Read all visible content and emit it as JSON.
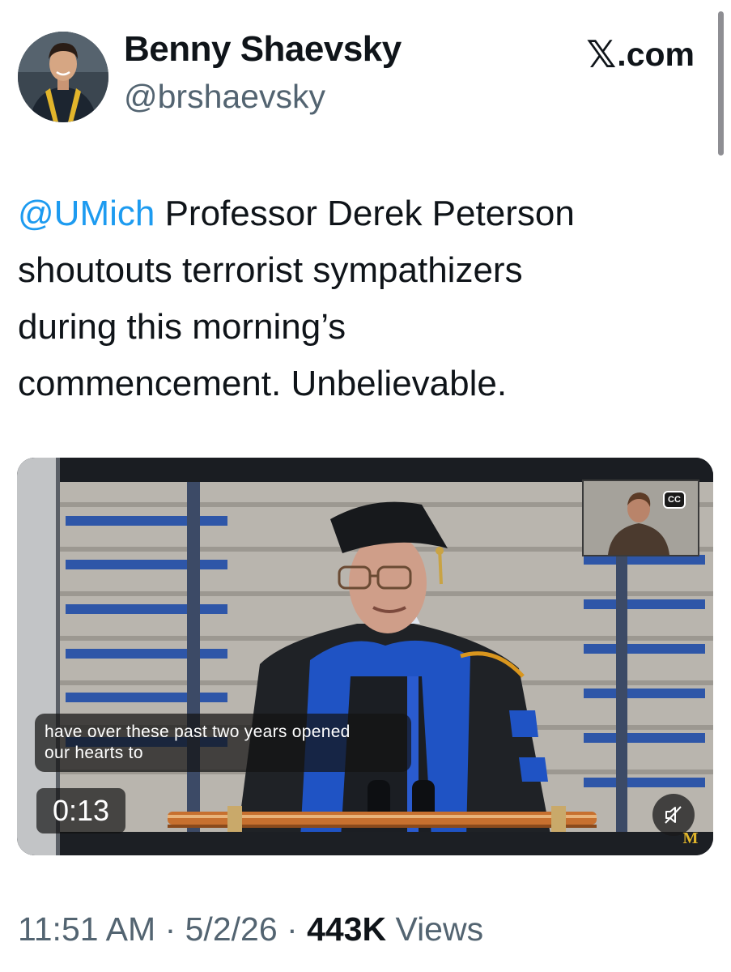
{
  "author": {
    "display_name": "Benny Shaevsky",
    "handle": "@brshaevsky"
  },
  "brand": {
    "logo_icon": "x-logo-icon",
    "label": ".com"
  },
  "tweet": {
    "mention": "@UMich",
    "lines": [
      " Professor Derek Peterson",
      "shoutouts terrorist sympathizers",
      "during this morning’s",
      "commencement. Unbelievable."
    ]
  },
  "video": {
    "cc_label": "CC",
    "caption_lines": [
      "have over these past two years opened",
      "our hearts to"
    ],
    "elapsed": "0:13",
    "watermark": "M",
    "muted": true
  },
  "meta": {
    "time": "11:51 AM",
    "separator": " · ",
    "date": "5/2/26",
    "views_count": "443K",
    "views_label": " Views"
  }
}
